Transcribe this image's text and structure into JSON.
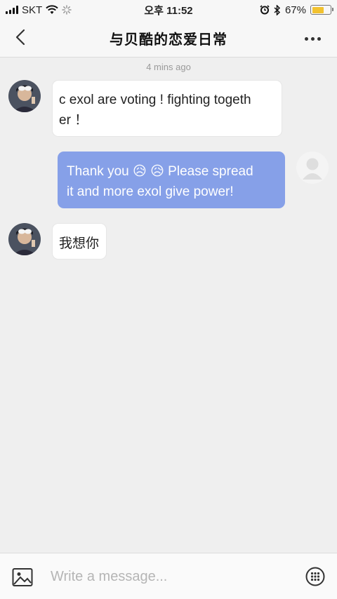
{
  "status_bar": {
    "carrier": "SKT",
    "time": "오후 11:52",
    "battery_percent": "67%",
    "battery_level": 0.67,
    "icons": [
      "signal-icon",
      "wifi-icon",
      "loading-icon",
      "alarm-icon",
      "bluetooth-icon",
      "battery-icon"
    ]
  },
  "header": {
    "title": "与贝酷的恋爱日常",
    "back_icon": "chevron-left-icon",
    "more_icon": "more-dots-icon"
  },
  "chat": {
    "timestamp": "4 mins ago",
    "messages": [
      {
        "direction": "in",
        "lines": [
          "c exol are voting ! fighting togeth",
          "er ！"
        ]
      },
      {
        "direction": "out",
        "lines": [
          "Thank you 😥 😥  Please spread",
          "it and more exol give power!"
        ]
      },
      {
        "direction": "in",
        "lines": [
          "我想你"
        ]
      }
    ]
  },
  "input_bar": {
    "placeholder": "Write a message...",
    "image_icon": "image-icon",
    "emoji_icon": "keypad-icon"
  },
  "colors": {
    "outgoing_bubble": "#86a0e8",
    "incoming_bubble": "#ffffff",
    "background": "#efefef",
    "battery": "#f2c230"
  }
}
